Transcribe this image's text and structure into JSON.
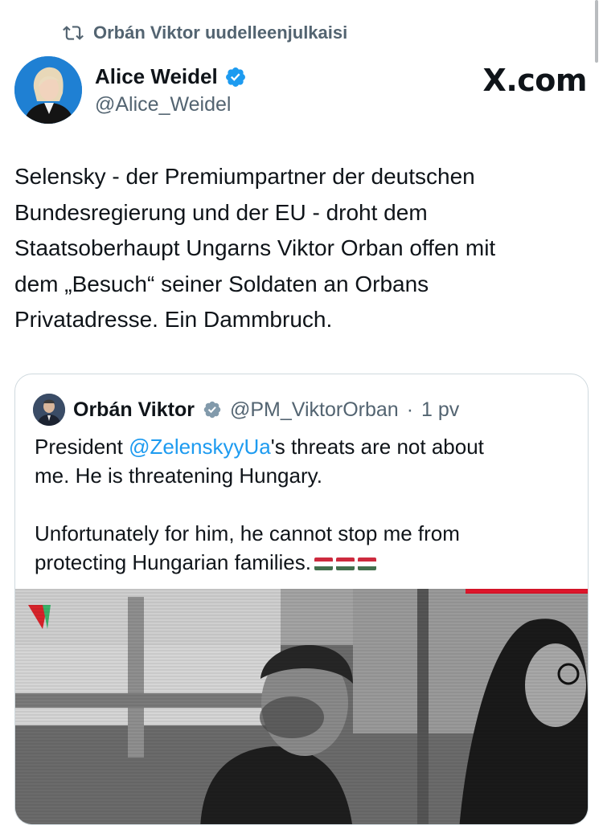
{
  "repost": {
    "text": "Orbán Viktor uudelleenjulkaisi",
    "icon": "repost-icon"
  },
  "author": {
    "name": "Alice Weidel",
    "handle": "@Alice_Weidel",
    "verified_icon": "verified-badge-icon",
    "avatar_icon": "avatar-photo"
  },
  "site_logo": "X.com",
  "tweet": {
    "text": "Selensky - der Premiumpartner der deutschen\nBundesregierung und der EU - droht dem\nStaatsoberhaupt Ungarns Viktor Orban offen mit\ndem „Besuch“ seiner Soldaten an Orbans\nPrivatadresse. Ein Dammbruch."
  },
  "quote": {
    "name": "Orbán Viktor",
    "handle": "@PM_ViktorOrban",
    "separator": "·",
    "time": "1 pv",
    "text_before_mention": "President ",
    "mention": "@ZelenskyyUa",
    "text_after_mention": "'s threats are not about\nme. He is threatening Hungary.\n\nUnfortunately for him, he cannot stop me from\nprotecting Hungarian families.",
    "flags": [
      "hungary-flag",
      "hungary-flag",
      "hungary-flag"
    ],
    "media_icon": "video-thumbnail"
  },
  "colors": {
    "text": "#0f1419",
    "secondary": "#536471",
    "link": "#1d9bf0",
    "border": "#cfd9de",
    "verified": "#1d9bf0"
  }
}
